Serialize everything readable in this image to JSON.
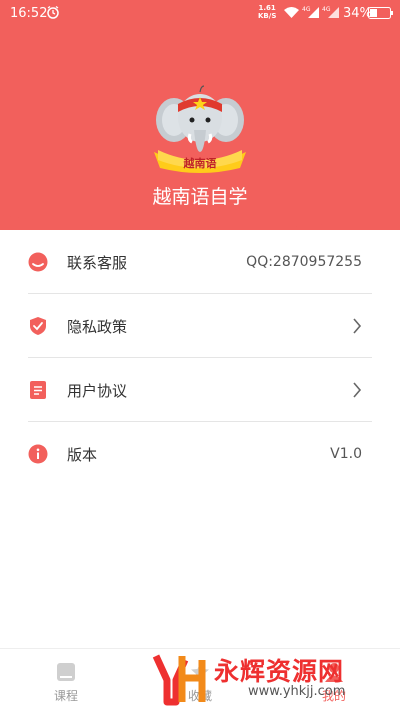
{
  "status_bar": {
    "time": "16:52",
    "net_speed_value": "1.61",
    "net_speed_unit": "KB/S",
    "signal1_label": "4G",
    "signal2_label": "4G",
    "battery": "34%"
  },
  "header": {
    "logo_text": "越南语",
    "title": "越南语自学",
    "background_color": "#f2605c"
  },
  "menu": {
    "items": [
      {
        "label": "联系客服",
        "value": "QQ:2870957255",
        "icon": "contact-service-icon"
      },
      {
        "label": "隐私政策",
        "value": "",
        "icon": "shield-check-icon"
      },
      {
        "label": "用户协议",
        "value": "",
        "icon": "document-icon"
      },
      {
        "label": "版本",
        "value": "V1.0",
        "icon": "info-icon"
      }
    ]
  },
  "tabbar": {
    "tabs": [
      {
        "label": "课程",
        "icon": "book-icon",
        "active": false
      },
      {
        "label": "收藏",
        "icon": "star-icon",
        "active": false
      },
      {
        "label": "我的",
        "icon": "person-icon",
        "active": true
      }
    ]
  },
  "watermark": {
    "text": "永辉资源网",
    "url": "www.yhkjj.com"
  }
}
